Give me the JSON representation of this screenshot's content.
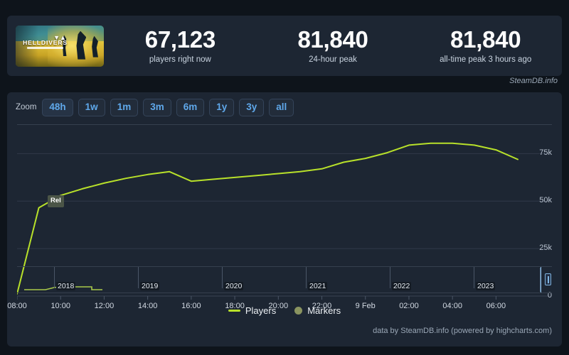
{
  "header": {
    "game_title": "HELLDIVERS",
    "game_subtitle": "II",
    "stats": [
      {
        "value": "67,123",
        "label": "players right now"
      },
      {
        "value": "81,840",
        "label": "24-hour peak"
      },
      {
        "value": "81,840",
        "label": "all-time peak 3 hours ago"
      }
    ],
    "brand": "SteamDB.info"
  },
  "controls": {
    "zoom_label": "Zoom",
    "ranges": [
      {
        "label": "48h",
        "active": true
      },
      {
        "label": "1w",
        "active": false
      },
      {
        "label": "1m",
        "active": false
      },
      {
        "label": "3m",
        "active": false
      },
      {
        "label": "6m",
        "active": false
      },
      {
        "label": "1y",
        "active": false
      },
      {
        "label": "3y",
        "active": false
      },
      {
        "label": "all",
        "active": false
      }
    ]
  },
  "legend": {
    "players": "Players",
    "markers": "Markers"
  },
  "credit": "data by SteamDB.info (powered by highcharts.com)",
  "navigator": {
    "years": [
      "2018",
      "2019",
      "2020",
      "2021",
      "2022",
      "2023"
    ]
  },
  "annotations": [
    {
      "label": "Rel",
      "x": "08:40",
      "y": 50000
    }
  ],
  "colors": {
    "line": "#b8e12a",
    "panel": "#1d2633",
    "page_bg": "#0e141b",
    "button_text": "#5fa8ea",
    "marker_dot": "#8a9460",
    "marker_badge": "#4b5547"
  },
  "chart_data": {
    "type": "line",
    "title": "",
    "xlabel": "",
    "ylabel": "",
    "ylim": [
      0,
      87500
    ],
    "yticks": [
      0,
      25000,
      50000,
      75000
    ],
    "ytick_labels": [
      "0",
      "25k",
      "50k",
      "75k"
    ],
    "grid": true,
    "legend_position": "bottom",
    "x": [
      "08:00",
      "09:00",
      "10:00",
      "11:00",
      "12:00",
      "13:00",
      "14:00",
      "15:00",
      "16:00",
      "17:00",
      "18:00",
      "19:00",
      "20:00",
      "21:00",
      "22:00",
      "23:00",
      "9 Feb",
      "01:00",
      "02:00",
      "03:00",
      "04:00",
      "05:00",
      "06:00",
      "07:00"
    ],
    "xtick_labels": [
      "08:00",
      "10:00",
      "12:00",
      "14:00",
      "16:00",
      "18:00",
      "20:00",
      "22:00",
      "9 Feb",
      "02:00",
      "04:00",
      "06:00"
    ],
    "series": [
      {
        "name": "Players",
        "color": "#b8e12a",
        "values": [
          1200,
          46500,
          53000,
          56500,
          59500,
          62000,
          64000,
          65500,
          60500,
          61500,
          62500,
          63500,
          64500,
          65500,
          67000,
          70500,
          72500,
          75500,
          79500,
          80500,
          80500,
          79500,
          77000,
          72000
        ]
      }
    ]
  }
}
